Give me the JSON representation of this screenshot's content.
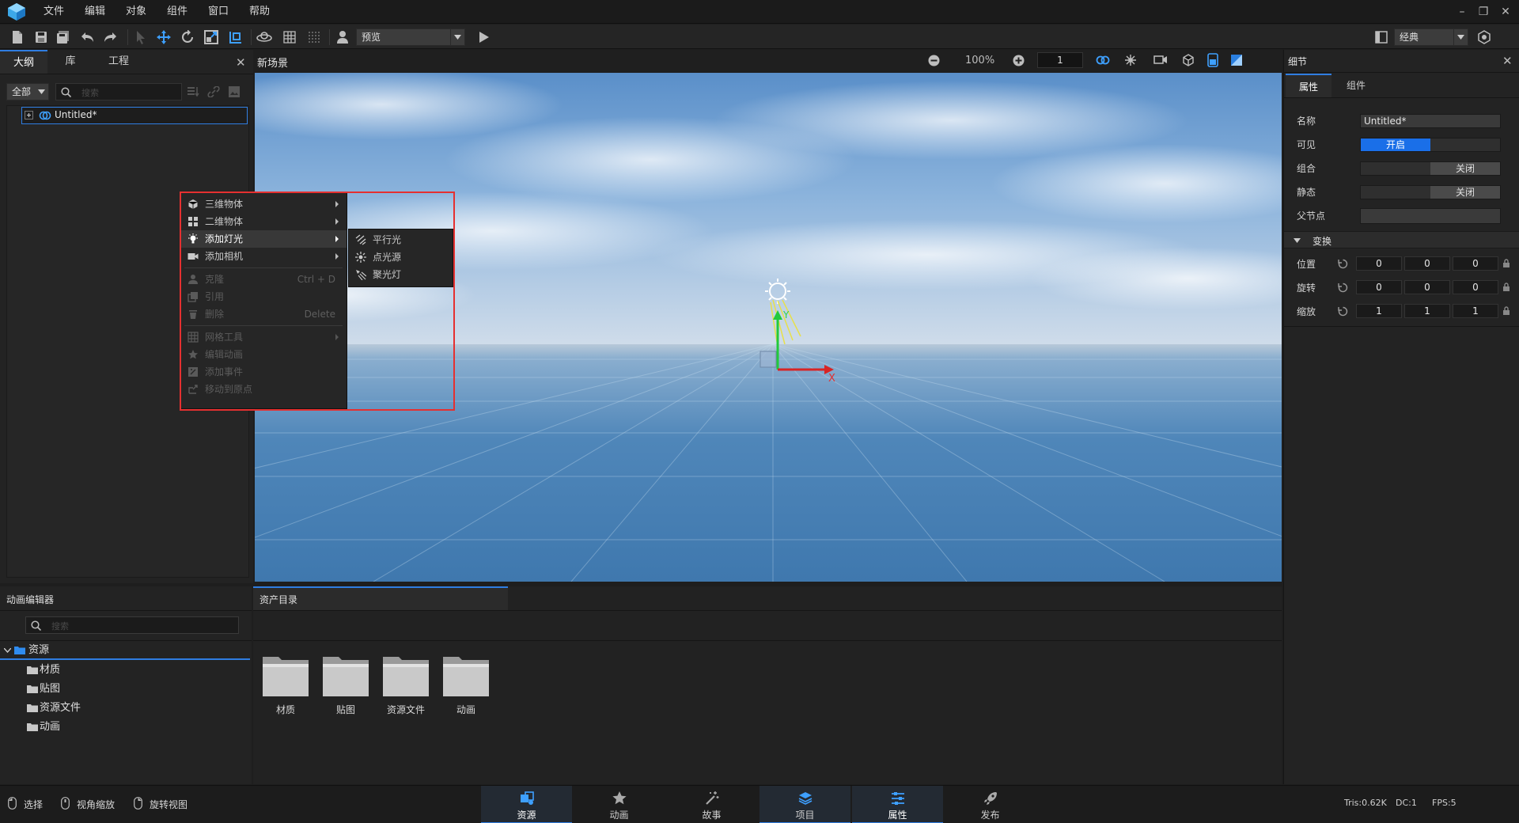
{
  "menubar": {
    "items": [
      "文件",
      "编辑",
      "对象",
      "组件",
      "窗口",
      "帮助"
    ]
  },
  "toolbar": {
    "mode_select": "预览",
    "layout_select": "经典"
  },
  "outline": {
    "tabs": [
      "大纲",
      "库",
      "工程"
    ],
    "filter": "全部",
    "search_placeholder": "搜索",
    "tree": [
      {
        "label": "Untitled*"
      }
    ]
  },
  "viewport": {
    "title": "新场景",
    "zoom": "100%",
    "layer": "1",
    "axis_x": "X",
    "axis_y": "Y"
  },
  "context_menu": {
    "items": [
      {
        "label": "三维物体",
        "icon": "cube-icon",
        "submenu": true,
        "enabled": true
      },
      {
        "label": "二维物体",
        "icon": "grid-icon",
        "submenu": true,
        "enabled": true
      },
      {
        "label": "添加灯光",
        "icon": "bulb-icon",
        "submenu": true,
        "enabled": true,
        "highlighted": true
      },
      {
        "label": "添加相机",
        "icon": "camera-icon",
        "submenu": true,
        "enabled": true
      },
      {
        "label": "克隆",
        "shortcut": "Ctrl + D",
        "icon": "clone-icon",
        "enabled": false
      },
      {
        "label": "引用",
        "icon": "reference-icon",
        "enabled": false
      },
      {
        "label": "删除",
        "shortcut": "Delete",
        "icon": "trash-icon",
        "enabled": false
      },
      {
        "label": "网格工具",
        "icon": "mesh-icon",
        "submenu": true,
        "enabled": false
      },
      {
        "label": "编辑动画",
        "icon": "animation-icon",
        "enabled": false
      },
      {
        "label": "添加事件",
        "icon": "event-icon",
        "enabled": false
      },
      {
        "label": "移动到原点",
        "icon": "origin-icon",
        "enabled": false
      }
    ],
    "submenu": [
      "平行光",
      "点光源",
      "聚光灯"
    ]
  },
  "anim_editor": {
    "title": "动画编辑器",
    "search_placeholder": "搜索",
    "tree_root": "资源",
    "tree_children": [
      "材质",
      "贴图",
      "资源文件",
      "动画"
    ]
  },
  "assets": {
    "tab": "资产目录",
    "folders": [
      "材质",
      "贴图",
      "资源文件",
      "动画"
    ]
  },
  "details": {
    "title": "细节",
    "tabs": [
      "属性",
      "组件"
    ],
    "name_label": "名称",
    "name_value": "Untitled*",
    "visible_label": "可见",
    "visible_value": "开启",
    "group_label": "组合",
    "group_value": "关闭",
    "static_label": "静态",
    "static_value": "关闭",
    "parent_label": "父节点",
    "transform_label": "变换",
    "position_label": "位置",
    "position": [
      "0",
      "0",
      "0"
    ],
    "rotation_label": "旋转",
    "rotation": [
      "0",
      "0",
      "0"
    ],
    "scale_label": "缩放",
    "scale": [
      "1",
      "1",
      "1"
    ]
  },
  "statusbar": {
    "hints": [
      "选择",
      "视角缩放",
      "旋转视图"
    ],
    "mode_tabs": [
      "资源",
      "动画",
      "故事",
      "项目",
      "属性",
      "发布"
    ],
    "stats": {
      "tris": "Tris:0.62K",
      "dc": "DC:1",
      "fps": "FPS:5"
    }
  },
  "colors": {
    "accent": "#2f7de1",
    "highlight_frame": "#e53030",
    "toggle_on": "#1a6fe8"
  }
}
